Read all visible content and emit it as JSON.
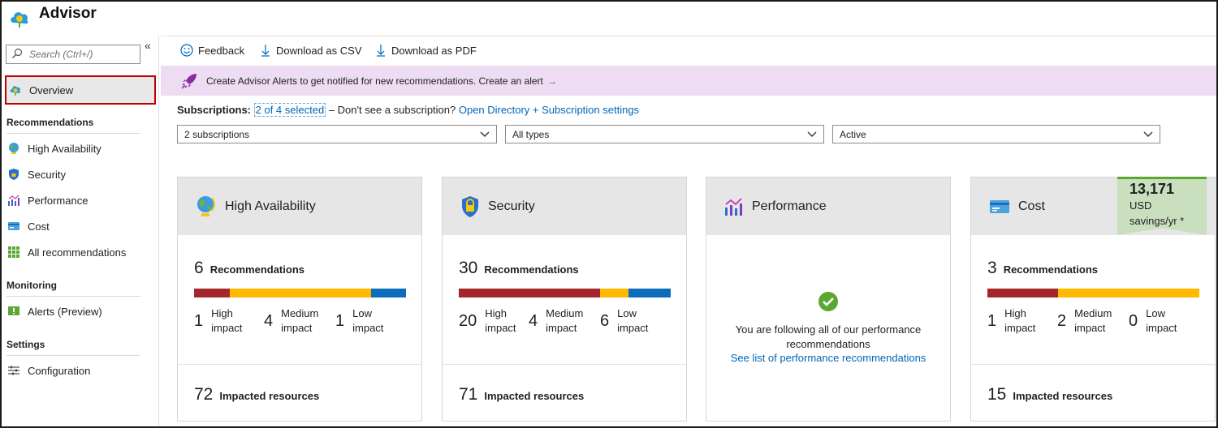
{
  "app": {
    "title": "Advisor"
  },
  "sidebar": {
    "search_placeholder": "Search (Ctrl+/)",
    "collapse_glyph": "«",
    "overview": "Overview",
    "sections": {
      "recommendations": "Recommendations",
      "monitoring": "Monitoring",
      "settings": "Settings"
    },
    "items": {
      "high_availability": "High Availability",
      "security": "Security",
      "performance": "Performance",
      "cost": "Cost",
      "all": "All recommendations",
      "alerts": "Alerts (Preview)",
      "configuration": "Configuration"
    }
  },
  "toolbar": {
    "feedback": "Feedback",
    "download_csv": "Download as CSV",
    "download_pdf": "Download as PDF"
  },
  "banner": {
    "text": "Create Advisor Alerts to get notified for new recommendations. Create an alert",
    "arrow": "→"
  },
  "subscriptions": {
    "label": "Subscriptions:",
    "selected": "2 of 4 selected",
    "question": "– Don't see a subscription?",
    "link": "Open Directory + Subscription settings"
  },
  "filters": {
    "subscriptions": "2 subscriptions",
    "types": "All types",
    "status": "Active"
  },
  "colors": {
    "high": "#a4262c",
    "medium": "#ffb900",
    "low": "#0f6cbd",
    "accent": "#0066b8"
  },
  "impact_labels": {
    "high": "High impact",
    "medium": "Medium impact",
    "low": "Low impact"
  },
  "cards": {
    "high_availability": {
      "title": "High Availability",
      "recommendations": "6",
      "rec_label": "Recommendations",
      "high": "1",
      "medium": "4",
      "low": "1",
      "resources": "72",
      "res_label": "Impacted resources"
    },
    "security": {
      "title": "Security",
      "recommendations": "30",
      "rec_label": "Recommendations",
      "high": "20",
      "medium": "4",
      "low": "6",
      "resources": "71",
      "res_label": "Impacted resources"
    },
    "performance": {
      "title": "Performance",
      "message": "You are following all of our performance recommendations",
      "link": "See list of performance recommendations"
    },
    "cost": {
      "title": "Cost",
      "savings_amount": "13,171",
      "savings_unit": "USD",
      "savings_period": "savings/yr *",
      "recommendations": "3",
      "rec_label": "Recommendations",
      "high": "1",
      "medium": "2",
      "low": "0",
      "resources": "15",
      "res_label": "Impacted resources"
    }
  }
}
